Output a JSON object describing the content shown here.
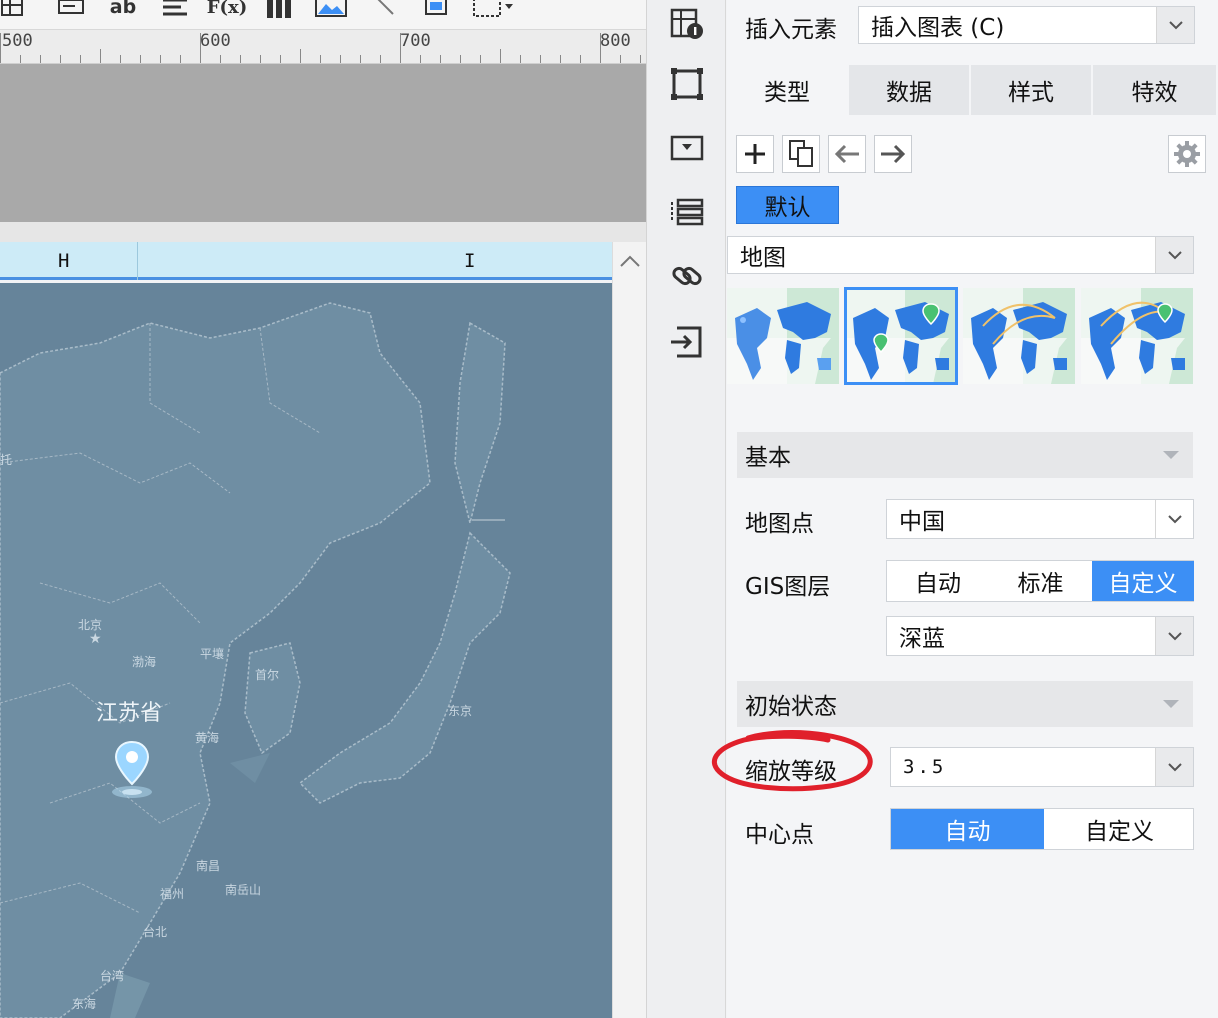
{
  "toolbar": {
    "icons": [
      "table-icon",
      "text-field-icon",
      "text-ab-icon",
      "align-left-icon",
      "formula-icon",
      "bar-chart-icon",
      "image-icon",
      "slash-tool-icon",
      "frame-icon",
      "border-dropdown-icon"
    ],
    "ab_label": "ab",
    "formula_label": "F(x)"
  },
  "ruler": {
    "marks": [
      "500",
      "600",
      "700",
      "800"
    ]
  },
  "sheet": {
    "columns": [
      "H",
      "I"
    ]
  },
  "map": {
    "province_label": "江苏省",
    "place_labels": [
      "北京",
      "渤海",
      "平壤",
      "首尔",
      "黄海",
      "东京",
      "南昌",
      "福州",
      "台北",
      "台湾",
      "东海",
      "南岳山"
    ]
  },
  "icon_strip": {
    "icons": [
      "cell-attributes-icon",
      "widget-frame-icon",
      "dropdown-widget-icon",
      "layers-icon",
      "link-icon",
      "export-icon"
    ]
  },
  "panel": {
    "insert_element_label": "插入元素",
    "insert_element_value": "插入图表 (C)",
    "tabs": [
      {
        "label": "类型",
        "active": true
      },
      {
        "label": "数据",
        "active": false
      },
      {
        "label": "样式",
        "active": false
      },
      {
        "label": "特效",
        "active": false
      }
    ],
    "tool_buttons": [
      "add-icon",
      "copy-icon",
      "arrow-left-icon",
      "arrow-right-icon"
    ],
    "settings_icon": "gear-icon",
    "default_tag": "默认",
    "chart_type": "地图",
    "thumbnails": [
      "area-map",
      "point-map",
      "flow-map",
      "flow-point-map"
    ],
    "selected_thumbnail": 1,
    "basic_section": {
      "title": "基本",
      "map_point_label": "地图点",
      "map_point_value": "中国",
      "gis_label": "GIS图层",
      "gis_options": [
        "自动",
        "标准",
        "自定义"
      ],
      "gis_selected": "自定义",
      "gis_style_value": "深蓝"
    },
    "initial_section": {
      "title": "初始状态",
      "zoom_label": "缩放等级",
      "zoom_value": "3.5",
      "center_label": "中心点",
      "center_options": [
        "自动",
        "自定义"
      ],
      "center_selected": "自动"
    }
  },
  "colors": {
    "accent": "#3c8ff5",
    "map_bg": "#66849a",
    "annotation": "#e0202b"
  }
}
